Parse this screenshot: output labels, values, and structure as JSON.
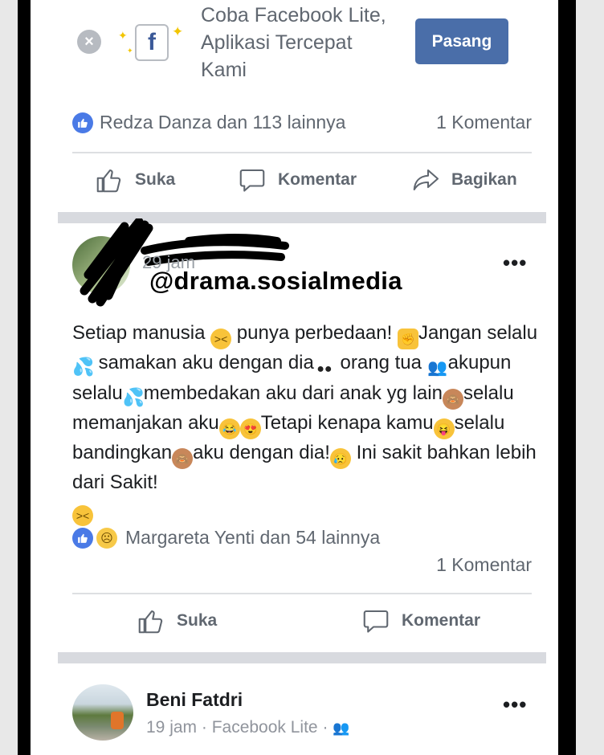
{
  "promo": {
    "line1": "Coba Facebook Lite,",
    "line2": "Aplikasi Tercepat",
    "line3": "Kami",
    "button": "Pasang",
    "close_glyph": "×",
    "logo_glyph": "f"
  },
  "post1": {
    "reactions_text": "Redza Danza dan 113 lainnya",
    "comments_text": "1 Komentar",
    "actions": {
      "like": "Suka",
      "comment": "Komentar",
      "share": "Bagikan"
    }
  },
  "post2": {
    "watermark": "@drama.sosialmedia",
    "more_glyph": "•••",
    "text_segments": [
      "Setiap manusia ",
      " punya perbedaan! ",
      "Jangan selalu ",
      " samakan aku dengan dia",
      " orang tua ",
      "akupun selalu",
      "membedakan aku dari anak yg lain",
      "selalu memanjakan aku",
      "Tetapi kenapa kamu",
      "selalu bandingkan",
      "aku dengan dia!",
      " Ini sakit bahkan lebih dari Sakit!"
    ],
    "reactions_text": "Margareta Yenti dan 54 lainnya",
    "comments_text": "1 Komentar",
    "actions": {
      "like": "Suka",
      "comment": "Komentar"
    }
  },
  "post3": {
    "author": "Beni Fatdri",
    "meta": "19 jam · Facebook Lite ·",
    "more_glyph": "•••"
  },
  "colors": {
    "accent": "#4a6ea9",
    "like_blue": "#4a7ae6",
    "separator": "#d8dadf"
  }
}
